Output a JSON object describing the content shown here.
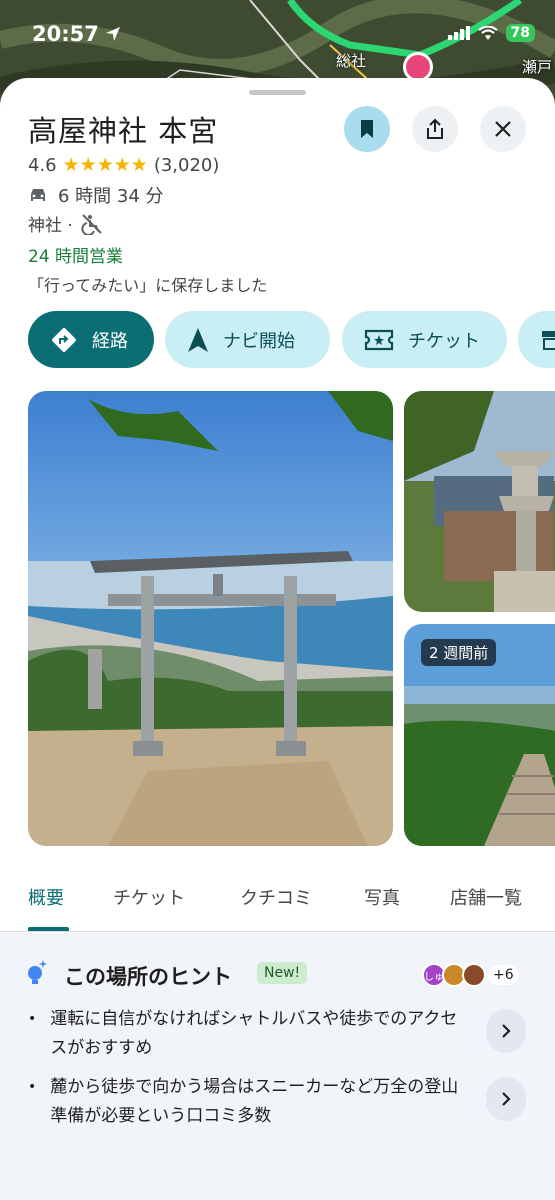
{
  "status": {
    "time": "20:57",
    "battery": "78"
  },
  "map": {
    "labels": [
      "総社",
      "瀬戸"
    ]
  },
  "place": {
    "title": "高屋神社 本宮",
    "rating": "4.6",
    "stars": "★★★★★",
    "review_count": "(3,020)",
    "drive_time": "6 時間 34 分",
    "category": "神社 ·",
    "hours": "24 時間営業",
    "saved_note": "「行ってみたい」に保存しました"
  },
  "actions": {
    "route": "経路",
    "navi": "ナビ開始",
    "ticket": "チケット"
  },
  "photos": {
    "badge": "2 週間前"
  },
  "tabs": [
    "概要",
    "チケット",
    "クチコミ",
    "写真",
    "店舗一覧"
  ],
  "hints": {
    "title": "この場所のヒント",
    "new_badge": "New!",
    "avatar_text": "しゅ",
    "extra_count": "+6",
    "items": [
      "運転に自信がなければシャトルバスや徒歩でのアクセスがおすすめ",
      "麓から徒歩で向かう場合はスニーカーなど万全の登山準備が必要という口コミ多数"
    ]
  },
  "colors": {
    "accent": "#0b6e74",
    "chip_bg": "#c9eef5",
    "open_green": "#188038",
    "star": "#f4b400"
  }
}
